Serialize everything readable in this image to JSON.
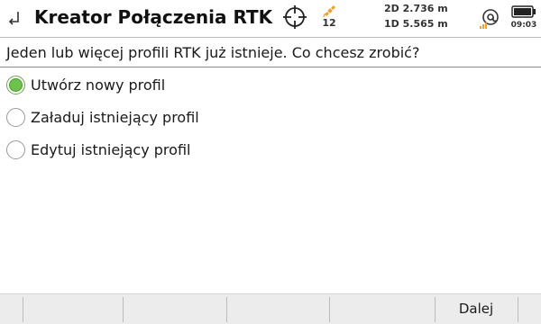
{
  "header": {
    "title": "Kreator Połączenia RTK",
    "back_icon": "back-arrow-icon",
    "crosshair_icon": "crosshair-icon",
    "satellite_icon": "satellite-icon",
    "satellite_count": "12",
    "precision_2d": "2D 2.736 m",
    "precision_1d": "1D 5.565 m",
    "link_icon": "rtk-link-icon",
    "battery_icon": "battery-icon",
    "time": "09:03"
  },
  "question": "Jeden lub więcej profili RTK już istnieje. Co chcesz zrobić?",
  "options": [
    {
      "label": "Utwórz nowy profil",
      "selected": true
    },
    {
      "label": "Załaduj istniejący profil",
      "selected": false
    },
    {
      "label": "Edytuj istniejący profil",
      "selected": false
    }
  ],
  "footer": {
    "next_label": "Dalej"
  },
  "colors": {
    "radio_selected": "#6cc24a",
    "satellite_icon": "#f0a030",
    "link_signal": "#f0a030",
    "footer_bg": "#ececec"
  }
}
